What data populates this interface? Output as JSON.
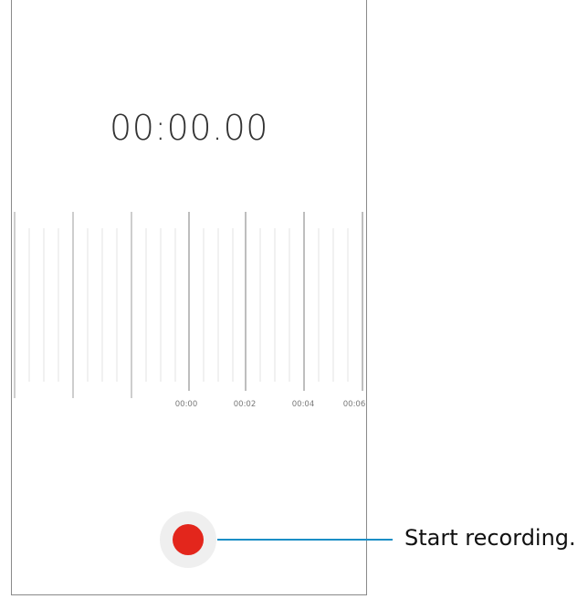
{
  "app": {
    "timer_display": "00:00.00"
  },
  "timeline": {
    "tick_labels": [
      "00:00",
      "00:02",
      "00:04",
      "00:06"
    ]
  },
  "controls": {
    "record_button_icon": "record-dot-icon",
    "record_color": "#e3261c"
  },
  "callout": {
    "label": "Start recording.",
    "line_color": "#1a8ec6"
  }
}
